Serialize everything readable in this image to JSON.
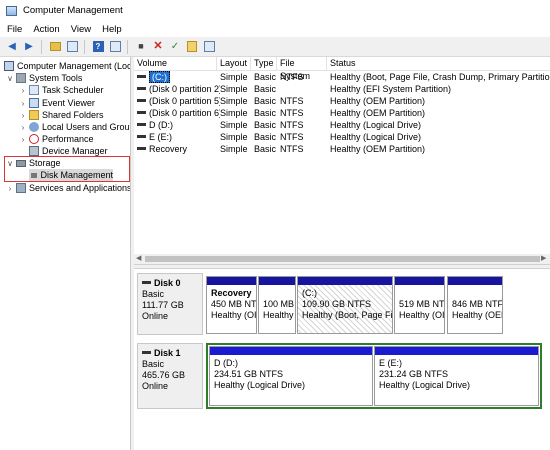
{
  "window": {
    "title": "Computer Management"
  },
  "menu": [
    "File",
    "Action",
    "View",
    "Help"
  ],
  "toolbar": {
    "buttons": [
      "back-arrow-icon",
      "forward-arrow-icon",
      "up-folder-icon",
      "properties-icon",
      "help-icon",
      "console-icon",
      "connect-icon",
      "delete-icon",
      "check-icon",
      "folder-open-icon",
      "search-icon"
    ]
  },
  "tree": {
    "root": "Computer Management (Local",
    "system_tools": "System Tools",
    "task_scheduler": "Task Scheduler",
    "event_viewer": "Event Viewer",
    "shared_folders": "Shared Folders",
    "local_users": "Local Users and Groups",
    "performance": "Performance",
    "device_manager": "Device Manager",
    "storage": "Storage",
    "disk_management": "Disk Management",
    "services": "Services and Applications"
  },
  "volumes": {
    "columns": [
      "Volume",
      "Layout",
      "Type",
      "File System",
      "Status"
    ],
    "rows": [
      {
        "volume": "(C:)",
        "layout": "Simple",
        "type": "Basic",
        "fs": "NTFS",
        "status": "Healthy (Boot, Page File, Crash Dump, Primary Partition)"
      },
      {
        "volume": "(Disk 0 partition 2)",
        "layout": "Simple",
        "type": "Basic",
        "fs": "",
        "status": "Healthy (EFI System Partition)"
      },
      {
        "volume": "(Disk 0 partition 5)",
        "layout": "Simple",
        "type": "Basic",
        "fs": "NTFS",
        "status": "Healthy (OEM Partition)"
      },
      {
        "volume": "(Disk 0 partition 6)",
        "layout": "Simple",
        "type": "Basic",
        "fs": "NTFS",
        "status": "Healthy (OEM Partition)"
      },
      {
        "volume": "D (D:)",
        "layout": "Simple",
        "type": "Basic",
        "fs": "NTFS",
        "status": "Healthy (Logical Drive)"
      },
      {
        "volume": "E (E:)",
        "layout": "Simple",
        "type": "Basic",
        "fs": "NTFS",
        "status": "Healthy (Logical Drive)"
      },
      {
        "volume": "Recovery",
        "layout": "Simple",
        "type": "Basic",
        "fs": "NTFS",
        "status": "Healthy (OEM Partition)"
      }
    ]
  },
  "disks": {
    "disk0": {
      "name": "Disk 0",
      "type": "Basic",
      "size": "111.77 GB",
      "state": "Online",
      "partitions": [
        {
          "name": "Recovery",
          "size": "450 MB NTI",
          "status": "Healthy (OI"
        },
        {
          "name": "",
          "size": "100 MB",
          "status": "Healthy"
        },
        {
          "name": "(C:)",
          "size": "109.90 GB NTFS",
          "status": "Healthy (Boot, Page File"
        },
        {
          "name": "",
          "size": "519 MB NTI",
          "status": "Healthy (OI"
        },
        {
          "name": "",
          "size": "846 MB NTFS",
          "status": "Healthy (OEM"
        }
      ]
    },
    "disk1": {
      "name": "Disk 1",
      "type": "Basic",
      "size": "465.76 GB",
      "state": "Online",
      "partitions": [
        {
          "name": "D  (D:)",
          "size": "234.51 GB NTFS",
          "status": "Healthy (Logical Drive)"
        },
        {
          "name": "E  (E:)",
          "size": "231.24 GB NTFS",
          "status": "Healthy (Logical Drive)"
        }
      ]
    }
  },
  "colors": {
    "primary_partition": "#1515a0",
    "logical_partition": "#1a1ad0",
    "extended_frame": "#2d7d2d",
    "highlight_box": "#dd3333"
  }
}
